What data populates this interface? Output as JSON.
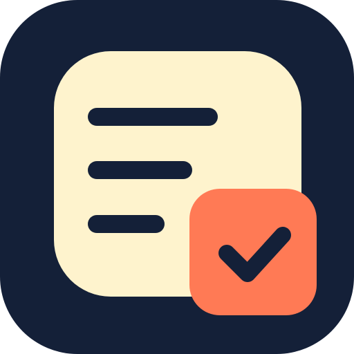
{
  "app_icon": {
    "icon_name": "checklist-app-icon",
    "colors": {
      "page_background": "#ffffff",
      "tile": "#142038",
      "document": "#FEF3CD",
      "lines": "#142038",
      "badge": "#FF7A55",
      "check": "#142038"
    },
    "parts": {
      "document_icon": "document-icon",
      "badge_icon": "checkmark-badge-icon",
      "check_icon": "checkmark-icon"
    }
  }
}
